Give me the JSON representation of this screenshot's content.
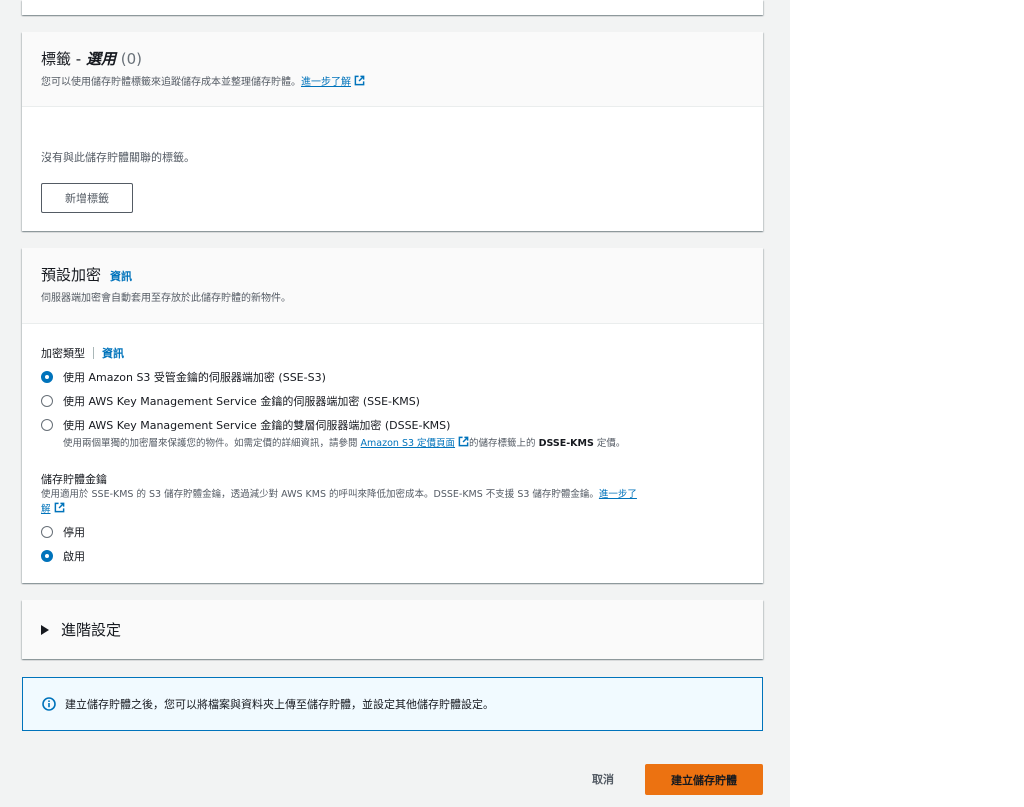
{
  "tags": {
    "title_prefix": "標籤 - ",
    "title_optional": "選用",
    "title_count": "(0)",
    "description": "您可以使用儲存貯體標籤來追蹤儲存成本並整理儲存貯體。",
    "learn_more": "進一步了解",
    "empty_text": "沒有與此儲存貯體關聯的標籤。",
    "add_button": "新增標籤"
  },
  "encryption": {
    "title": "預設加密",
    "info": "資訊",
    "description": "伺服器端加密會自動套用至存放於此儲存貯體的新物件。",
    "type_label": "加密類型",
    "type_info": "資訊",
    "options": [
      {
        "label": "使用 Amazon S3 受管金鑰的伺服器端加密 (SSE-S3)",
        "selected": true
      },
      {
        "label": "使用 AWS Key Management Service 金鑰的伺服器端加密 (SSE-KMS)",
        "selected": false
      },
      {
        "label": "使用 AWS Key Management Service 金鑰的雙層伺服器端加密 (DSSE-KMS)",
        "selected": false
      }
    ],
    "dsse_desc_prefix": "使用兩個單獨的加密層來保護您的物件。如需定價的詳細資訊，請參閱 ",
    "dsse_desc_link": "Amazon S3 定價頁面",
    "dsse_desc_mid": "的儲存標籤上的 ",
    "dsse_desc_bold": "DSSE-KMS",
    "dsse_desc_suffix": " 定價。",
    "bucket_key_label": "儲存貯體金鑰",
    "bucket_key_desc": "使用適用於 SSE-KMS 的 S3 儲存貯體金鑰，透過減少對 AWS KMS 的呼叫來降低加密成本。DSSE-KMS 不支援 S3 儲存貯體金鑰。",
    "bucket_key_learn_more_1": "進一步了",
    "bucket_key_learn_more_2": "解",
    "bucket_key_options": [
      {
        "label": "停用",
        "selected": false
      },
      {
        "label": "啟用",
        "selected": true
      }
    ]
  },
  "advanced": {
    "title": "進階設定"
  },
  "flash": {
    "message": "建立儲存貯體之後，您可以將檔案與資料夾上傳至儲存貯體，並設定其他儲存貯體設定。"
  },
  "footer": {
    "cancel": "取消",
    "create": "建立儲存貯體"
  },
  "colors": {
    "link": "#0073bb",
    "primary": "#ec7211",
    "info_bg": "#f1faff"
  }
}
